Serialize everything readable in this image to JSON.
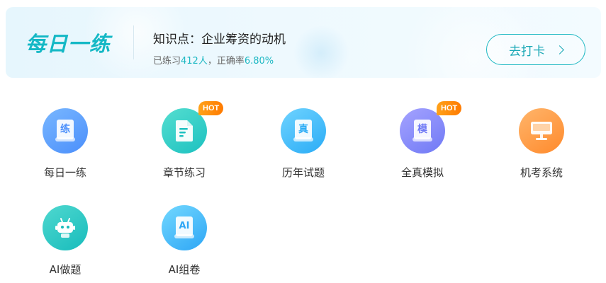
{
  "banner": {
    "brand": "每日一练",
    "knowledge_label": "知识点：",
    "knowledge_topic": "企业筹资的动机",
    "stats_prefix": "已练习",
    "practiced_count": "412人",
    "stats_mid": "，正确率",
    "accuracy": "6.80%",
    "checkin_label": "去打卡"
  },
  "colors": {
    "accent": "#1db8c3",
    "brand_accent": "#f5a623",
    "hot": "#ff8a00"
  },
  "features": [
    {
      "label": "每日一练",
      "icon": "daily-practice-icon",
      "icon_char": "练",
      "hot": false
    },
    {
      "label": "章节练习",
      "icon": "chapter-doc-icon",
      "icon_char": "",
      "hot": true,
      "badge": "HOT"
    },
    {
      "label": "历年试题",
      "icon": "past-exam-icon",
      "icon_char": "真",
      "hot": false
    },
    {
      "label": "全真模拟",
      "icon": "mock-exam-icon",
      "icon_char": "模",
      "hot": true,
      "badge": "HOT"
    },
    {
      "label": "机考系统",
      "icon": "computer-exam-icon",
      "icon_char": "",
      "hot": false
    },
    {
      "label": "AI做题",
      "icon": "ai-robot-icon",
      "icon_char": "",
      "hot": false
    },
    {
      "label": "AI组卷",
      "icon": "ai-paper-icon",
      "icon_char": "AI",
      "hot": false
    }
  ]
}
